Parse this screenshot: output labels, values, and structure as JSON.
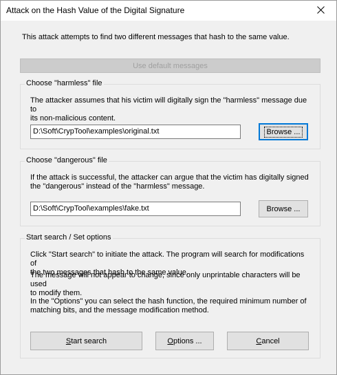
{
  "window": {
    "title": "Attack on the Hash Value of the Digital Signature",
    "close_icon": "close-icon"
  },
  "intro_text": "This attack attempts to find two different messages that hash to the same value.",
  "default_button_label": "Use default messages",
  "harmless": {
    "legend": "Choose \"harmless\" file",
    "description_line1": "The attacker assumes that his victim will digitally sign the \"harmless\" message due to",
    "description_line2": "its non-malicious content.",
    "path": "D:\\Soft\\CrypTool\\examples\\original.txt",
    "browse_label": "Browse ..."
  },
  "dangerous": {
    "legend": "Choose \"dangerous\" file",
    "description_line1": "If the attack is successful, the attacker can argue that the victim has digitally signed",
    "description_line2": "the \"dangerous\" instead of the \"harmless\" message.",
    "path": "D:\\Soft\\CrypTool\\examples\\fake.txt",
    "browse_label": "Browse ..."
  },
  "search": {
    "legend": "Start search / Set options",
    "para1_line1": "Click \"Start search\" to initiate the attack. The program will search for modifications of",
    "para1_line2": "the two messages that hash to the same value.",
    "para2_line1": "The message will not appear to change, since only unprintable characters will be used",
    "para2_line2": "to modify them.",
    "para3_line1": "In the \"Options\" you can select the hash function, the required minimum number of",
    "para3_line2": "matching bits, and the message modification method.",
    "start": {
      "underlined": "S",
      "rest": "tart search"
    },
    "options": {
      "underlined": "O",
      "rest": "ptions ..."
    },
    "cancel": {
      "underlined": "C",
      "rest": "ancel"
    }
  }
}
